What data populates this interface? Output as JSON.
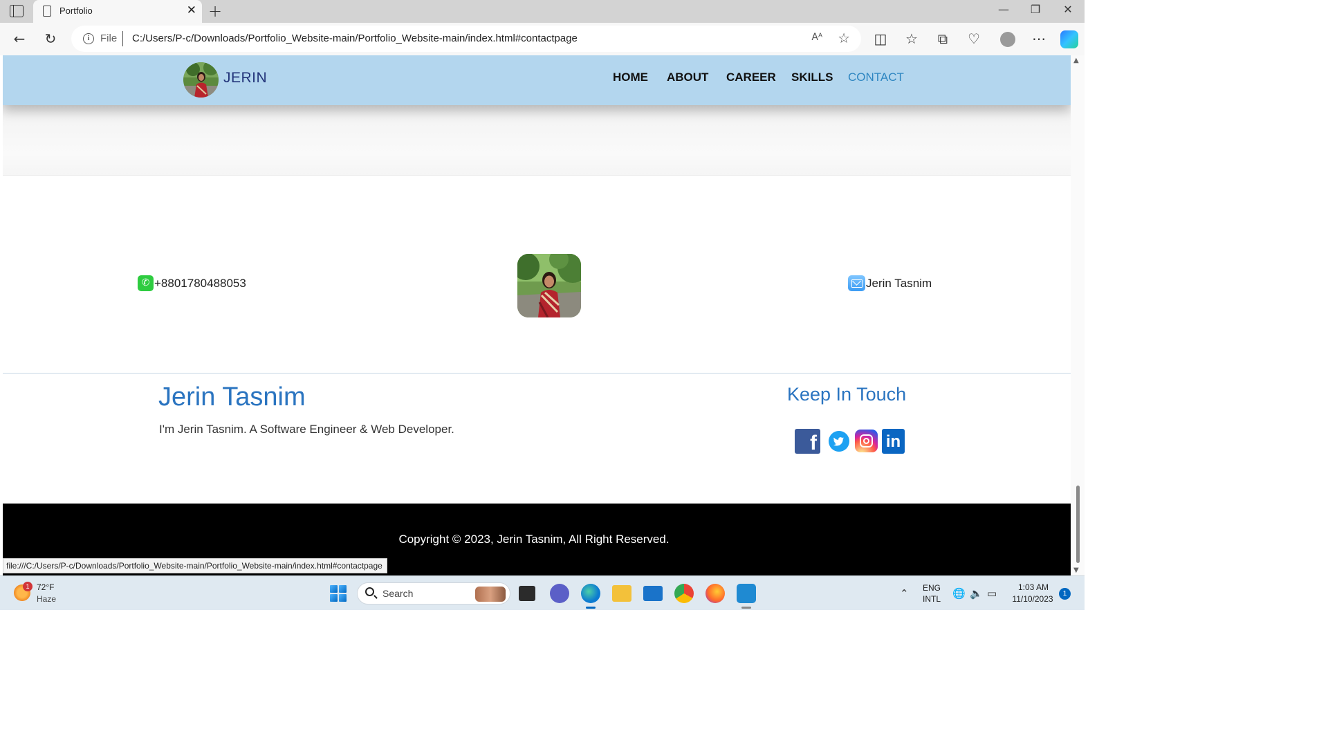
{
  "browser": {
    "tab_title": "Portfolio",
    "address_scheme_label": "File",
    "url": "C:/Users/P-c/Downloads/Portfolio_Website-main/Portfolio_Website-main/index.html#contactpage",
    "status_url": "file:///C:/Users/P-c/Downloads/Portfolio_Website-main/Portfolio_Website-main/index.html#contactpage",
    "read_aloud_label": "Aᴬ"
  },
  "navbar": {
    "brand": "JERIN",
    "links": [
      {
        "label": "HOME",
        "active": false
      },
      {
        "label": "ABOUT",
        "active": false
      },
      {
        "label": "CAREER",
        "active": false
      },
      {
        "label": "SKILLS",
        "active": false
      },
      {
        "label": "CONTACT",
        "active": true
      }
    ]
  },
  "contact": {
    "phone": "+8801780488053",
    "email_name": "Jerin Tasnim"
  },
  "footer": {
    "name": "Jerin Tasnim",
    "description": "I'm Jerin Tasnim. A Software Engineer & Web Developer.",
    "keep_in_touch": "Keep In Touch",
    "social_icons": [
      "facebook-icon",
      "twitter-icon",
      "instagram-icon",
      "linkedin-icon"
    ],
    "copyright": "Copyright © 2023, Jerin Tasnim, All Right Reserved."
  },
  "taskbar": {
    "weather_badge": "1",
    "weather_temp": "72°F",
    "weather_desc": "Haze",
    "search_label": "Search",
    "lang_top": "ENG",
    "lang_bottom": "INTL",
    "time": "1:03 AM",
    "date": "11/10/2023",
    "notification_count": "1"
  },
  "colors": {
    "navbar_bg": "#b3d6ee",
    "brand": "#23357a",
    "accent": "#2a74c0",
    "active_link": "#2e86c1",
    "footer_bar": "#000000"
  }
}
